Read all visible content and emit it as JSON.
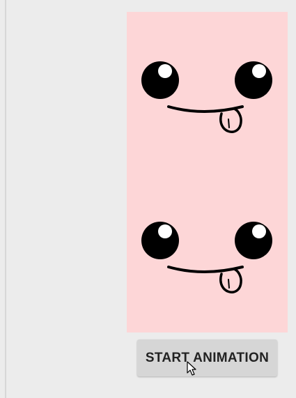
{
  "controls": {
    "start_button_label": "START ANIMATION"
  },
  "faces": [
    {
      "name": "face-top"
    },
    {
      "name": "face-bottom"
    }
  ],
  "colors": {
    "background": "#ececec",
    "panel": "#fdd6d7",
    "features": "#000000",
    "eye_highlight": "#ffffff",
    "button": "#d6d6d6",
    "button_text": "#222222"
  },
  "icons": {
    "cursor": "mouse-pointer-icon"
  }
}
